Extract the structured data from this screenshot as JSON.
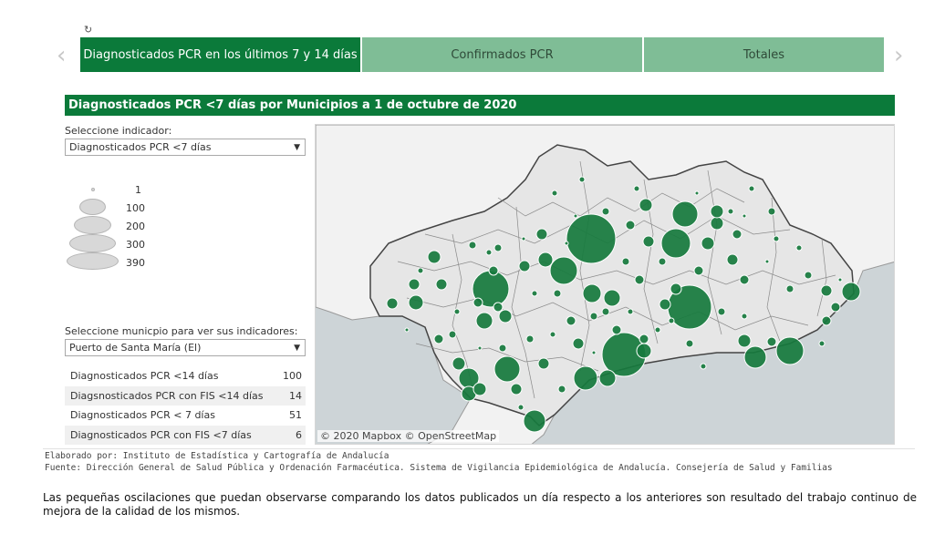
{
  "header": {
    "refresh_icon": "refresh-icon"
  },
  "tabs": [
    {
      "label": "Diagnosticados PCR en los últimos 7 y 14 días",
      "active": true
    },
    {
      "label": "Confirmados PCR",
      "active": false
    },
    {
      "label": "Totales",
      "active": false
    }
  ],
  "nav": {
    "prev_icon": "chevron-left-icon",
    "next_icon": "chevron-right-icon",
    "prev_glyph": "‹",
    "next_glyph": "›"
  },
  "section": {
    "title": "Diagnosticados PCR <7 días por Municipios a 1 de octubre de 2020"
  },
  "indicator": {
    "label": "Seleccione indicador:",
    "value": "Diagnosticados PCR <7 días"
  },
  "size_legend": {
    "values": [
      "1",
      "100",
      "200",
      "300",
      "390"
    ]
  },
  "municipio": {
    "label": "Seleccione municpio para ver sus indicadores:",
    "value": "Puerto de Santa María (El)"
  },
  "indicators_table": [
    {
      "label": "Diagnosticados PCR <14 días",
      "value": "100"
    },
    {
      "label": "Diagsnosticados PCR con FIS <14 días",
      "value": "14"
    },
    {
      "label": "Diagnosticados PCR < 7 días",
      "value": "51"
    },
    {
      "label": "Diagnosticados PCR con FIS <7 días",
      "value": "6"
    }
  ],
  "map": {
    "attribution": "© 2020 Mapbox © OpenStreetMap",
    "bubble_color": "#167a3d",
    "land_color": "#f2f2f2",
    "sea_color": "#cdd4d7"
  },
  "footer": {
    "elaborado": "Elaborado por: Instituto de Estadística y Cartografía de Andalucía",
    "fuente": "Fuente: Dirección General de Salud Pública y Ordenación Farmacéutica. Sistema de Vigilancia Epidemiológica de Andalucía. Consejería de Salud y Familias"
  },
  "note": "Las pequeñas oscilaciones que puedan observarse comparando los datos publicados un día respecto a los anteriores son resultado del trabajo continuo de mejora de la calidad de los mismos."
}
